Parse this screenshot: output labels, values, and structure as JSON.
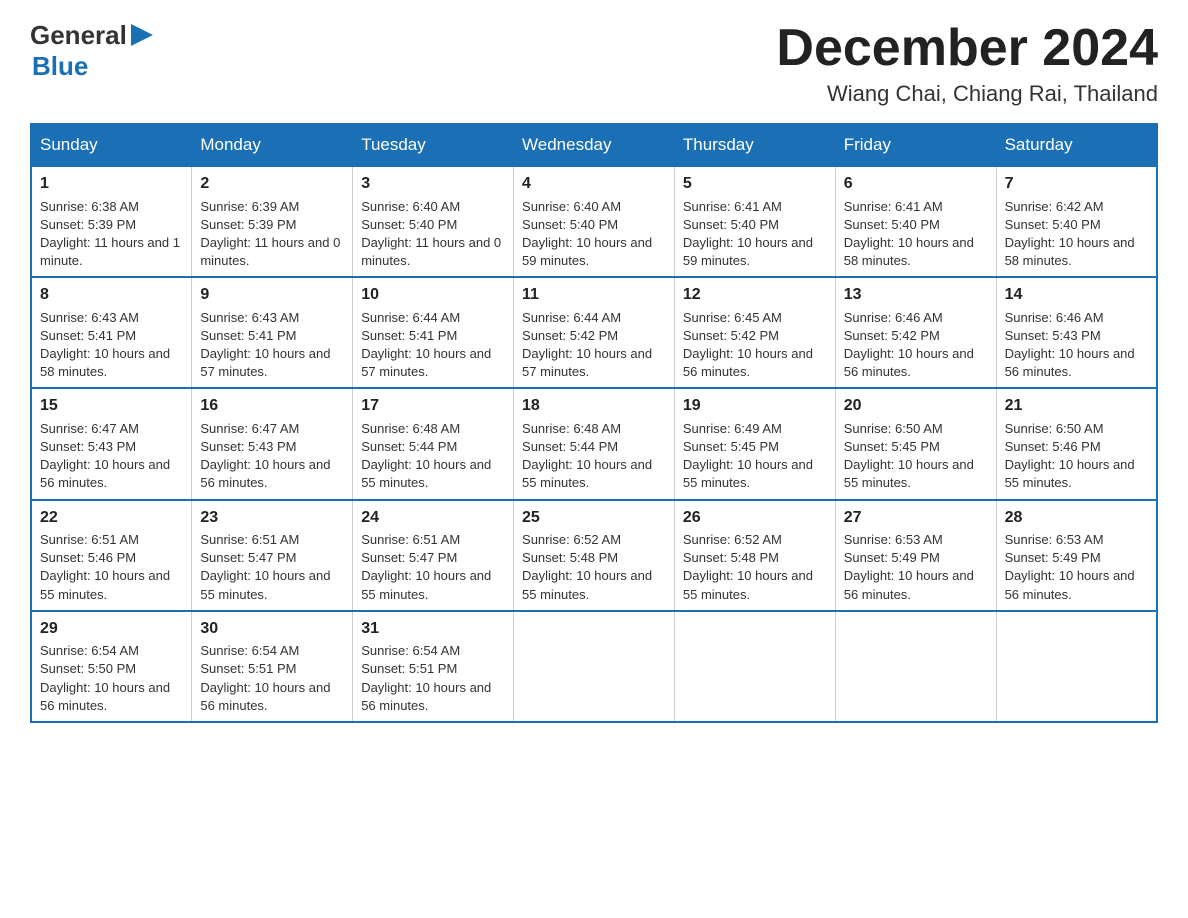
{
  "header": {
    "logo_general": "General",
    "logo_blue": "Blue",
    "month_title": "December 2024",
    "location": "Wiang Chai, Chiang Rai, Thailand"
  },
  "days_of_week": [
    "Sunday",
    "Monday",
    "Tuesday",
    "Wednesday",
    "Thursday",
    "Friday",
    "Saturday"
  ],
  "weeks": [
    [
      {
        "day": "1",
        "sunrise": "6:38 AM",
        "sunset": "5:39 PM",
        "daylight": "11 hours and 1 minute."
      },
      {
        "day": "2",
        "sunrise": "6:39 AM",
        "sunset": "5:39 PM",
        "daylight": "11 hours and 0 minutes."
      },
      {
        "day": "3",
        "sunrise": "6:40 AM",
        "sunset": "5:40 PM",
        "daylight": "11 hours and 0 minutes."
      },
      {
        "day": "4",
        "sunrise": "6:40 AM",
        "sunset": "5:40 PM",
        "daylight": "10 hours and 59 minutes."
      },
      {
        "day": "5",
        "sunrise": "6:41 AM",
        "sunset": "5:40 PM",
        "daylight": "10 hours and 59 minutes."
      },
      {
        "day": "6",
        "sunrise": "6:41 AM",
        "sunset": "5:40 PM",
        "daylight": "10 hours and 58 minutes."
      },
      {
        "day": "7",
        "sunrise": "6:42 AM",
        "sunset": "5:40 PM",
        "daylight": "10 hours and 58 minutes."
      }
    ],
    [
      {
        "day": "8",
        "sunrise": "6:43 AM",
        "sunset": "5:41 PM",
        "daylight": "10 hours and 58 minutes."
      },
      {
        "day": "9",
        "sunrise": "6:43 AM",
        "sunset": "5:41 PM",
        "daylight": "10 hours and 57 minutes."
      },
      {
        "day": "10",
        "sunrise": "6:44 AM",
        "sunset": "5:41 PM",
        "daylight": "10 hours and 57 minutes."
      },
      {
        "day": "11",
        "sunrise": "6:44 AM",
        "sunset": "5:42 PM",
        "daylight": "10 hours and 57 minutes."
      },
      {
        "day": "12",
        "sunrise": "6:45 AM",
        "sunset": "5:42 PM",
        "daylight": "10 hours and 56 minutes."
      },
      {
        "day": "13",
        "sunrise": "6:46 AM",
        "sunset": "5:42 PM",
        "daylight": "10 hours and 56 minutes."
      },
      {
        "day": "14",
        "sunrise": "6:46 AM",
        "sunset": "5:43 PM",
        "daylight": "10 hours and 56 minutes."
      }
    ],
    [
      {
        "day": "15",
        "sunrise": "6:47 AM",
        "sunset": "5:43 PM",
        "daylight": "10 hours and 56 minutes."
      },
      {
        "day": "16",
        "sunrise": "6:47 AM",
        "sunset": "5:43 PM",
        "daylight": "10 hours and 56 minutes."
      },
      {
        "day": "17",
        "sunrise": "6:48 AM",
        "sunset": "5:44 PM",
        "daylight": "10 hours and 55 minutes."
      },
      {
        "day": "18",
        "sunrise": "6:48 AM",
        "sunset": "5:44 PM",
        "daylight": "10 hours and 55 minutes."
      },
      {
        "day": "19",
        "sunrise": "6:49 AM",
        "sunset": "5:45 PM",
        "daylight": "10 hours and 55 minutes."
      },
      {
        "day": "20",
        "sunrise": "6:50 AM",
        "sunset": "5:45 PM",
        "daylight": "10 hours and 55 minutes."
      },
      {
        "day": "21",
        "sunrise": "6:50 AM",
        "sunset": "5:46 PM",
        "daylight": "10 hours and 55 minutes."
      }
    ],
    [
      {
        "day": "22",
        "sunrise": "6:51 AM",
        "sunset": "5:46 PM",
        "daylight": "10 hours and 55 minutes."
      },
      {
        "day": "23",
        "sunrise": "6:51 AM",
        "sunset": "5:47 PM",
        "daylight": "10 hours and 55 minutes."
      },
      {
        "day": "24",
        "sunrise": "6:51 AM",
        "sunset": "5:47 PM",
        "daylight": "10 hours and 55 minutes."
      },
      {
        "day": "25",
        "sunrise": "6:52 AM",
        "sunset": "5:48 PM",
        "daylight": "10 hours and 55 minutes."
      },
      {
        "day": "26",
        "sunrise": "6:52 AM",
        "sunset": "5:48 PM",
        "daylight": "10 hours and 55 minutes."
      },
      {
        "day": "27",
        "sunrise": "6:53 AM",
        "sunset": "5:49 PM",
        "daylight": "10 hours and 56 minutes."
      },
      {
        "day": "28",
        "sunrise": "6:53 AM",
        "sunset": "5:49 PM",
        "daylight": "10 hours and 56 minutes."
      }
    ],
    [
      {
        "day": "29",
        "sunrise": "6:54 AM",
        "sunset": "5:50 PM",
        "daylight": "10 hours and 56 minutes."
      },
      {
        "day": "30",
        "sunrise": "6:54 AM",
        "sunset": "5:51 PM",
        "daylight": "10 hours and 56 minutes."
      },
      {
        "day": "31",
        "sunrise": "6:54 AM",
        "sunset": "5:51 PM",
        "daylight": "10 hours and 56 minutes."
      },
      null,
      null,
      null,
      null
    ]
  ]
}
